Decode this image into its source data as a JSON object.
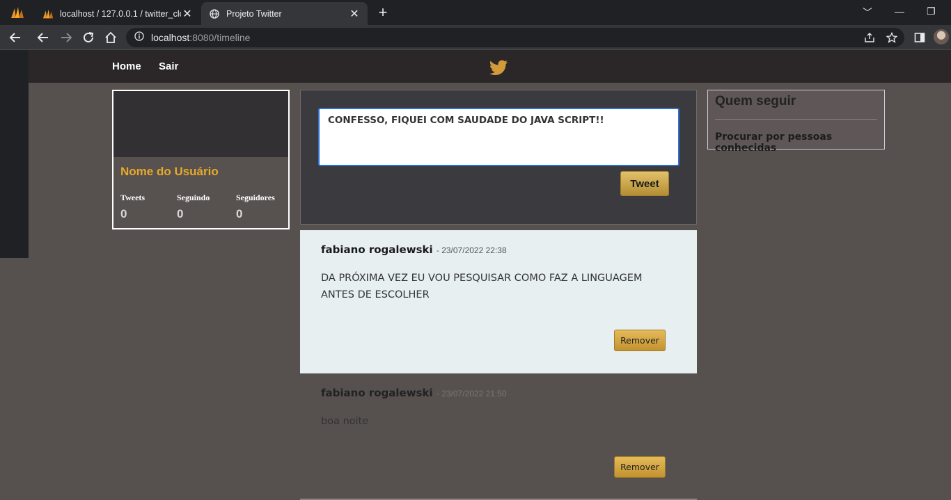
{
  "browser": {
    "tabs": [
      {
        "title": "localhost / 127.0.0.1 / twitter_clone",
        "active": false
      },
      {
        "title": "Projeto Twitter",
        "active": true
      }
    ],
    "new_tab": "+",
    "address": {
      "host": "localhost",
      "path": ":8080/timeline"
    },
    "window_controls": [
      "﹀",
      "—",
      "❐"
    ]
  },
  "nav": {
    "home_label": "Home",
    "logout_label": "Sair"
  },
  "profile": {
    "name": "Nome do Usuário",
    "stats": [
      {
        "label": "Tweets",
        "value": "0"
      },
      {
        "label": "Seguindo",
        "value": "0"
      },
      {
        "label": "Seguidores",
        "value": "0"
      }
    ]
  },
  "composer": {
    "text": "CONFESSO, FIQUEI COM SAUDADE DO JAVA SCRIPT!!",
    "button_label": "Tweet"
  },
  "posts": [
    {
      "author": "fabiano rogalewski",
      "date": "- 23/07/2022 22:38",
      "content": "DA PRÓXIMA VEZ EU VOU PESQUISAR COMO FAZ A LINGUAGEM ANTES DE ESCOLHER",
      "remove_label": "Remover"
    },
    {
      "author": "fabiano rogalewski",
      "date": "- 23/07/2022 21:50",
      "content": "boa noite",
      "remove_label": "Remover"
    }
  ],
  "follow": {
    "title": "Quem seguir",
    "link": "Procurar por pessoas conhecidas"
  },
  "colors": {
    "accent_gold": "#e9a92a",
    "page_bg": "#56504f",
    "navbar_bg": "#2b2728"
  }
}
